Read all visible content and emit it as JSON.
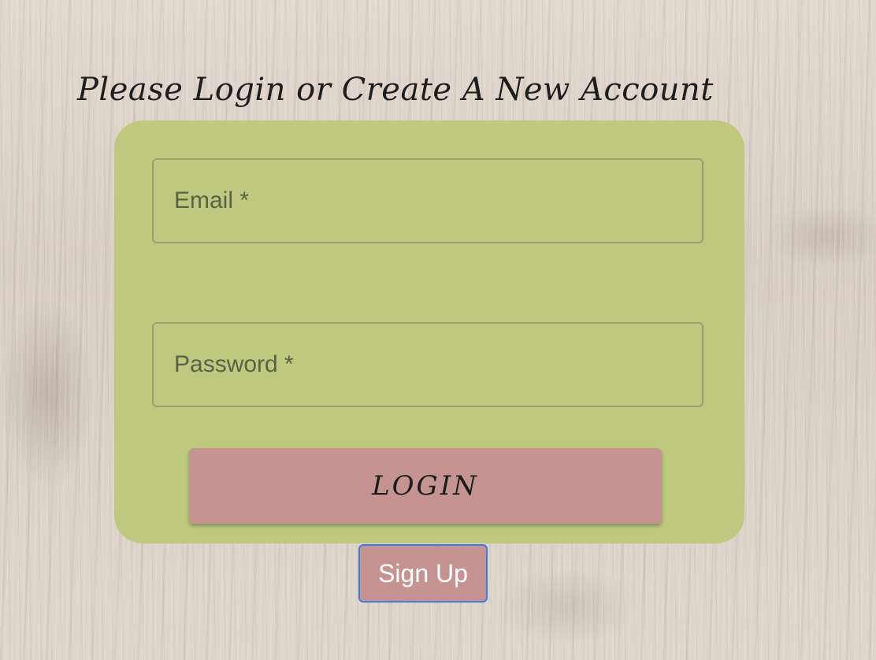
{
  "page": {
    "title": "Please Login or Create A New Account"
  },
  "login_form": {
    "email": {
      "placeholder": "Email *",
      "value": ""
    },
    "password": {
      "placeholder": "Password *",
      "value": ""
    },
    "login_label": "Login"
  },
  "signup": {
    "label": "Sign Up"
  },
  "colors": {
    "card_background": "#bec97f",
    "button_background": "#c69393",
    "focus_outline": "#3a7be0",
    "background": "#ddd2c8"
  }
}
